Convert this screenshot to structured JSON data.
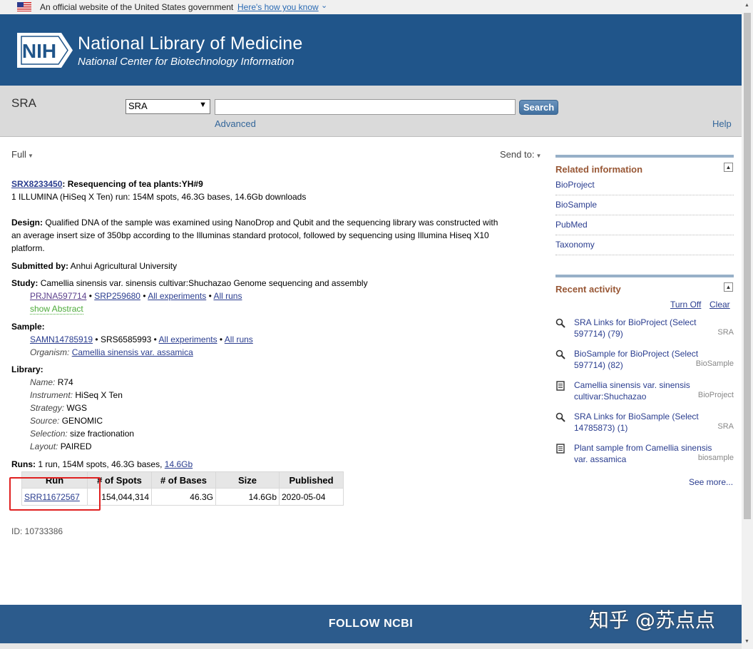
{
  "gov_banner": {
    "text": "An official website of the United States government",
    "link": "Here's how you know"
  },
  "header": {
    "logo_text": "NIH",
    "title": "National Library of Medicine",
    "subtitle": "National Center for Biotechnology Information"
  },
  "search": {
    "db_title": "SRA",
    "db_selected": "SRA",
    "term": "",
    "button": "Search",
    "advanced": "Advanced",
    "help": "Help"
  },
  "toolbar": {
    "format": "Full",
    "send_to": "Send to:"
  },
  "record": {
    "accession": "SRX8233450",
    "title": ": Resequencing of tea plants:YH#9",
    "summary": "1 ILLUMINA (HiSeq X Ten) run: 154M spots, 46.3G bases, 14.6Gb downloads",
    "design_label": "Design:",
    "design_line1": "Qualified DNA of the sample was examined using NanoDrop and Qubit and the sequencing library was constructed with",
    "design_line2": "an average insert size of 350bp according to the Illuminas standard protocol, followed by sequencing using Illumina Hiseq X10",
    "design_line3": "platform.",
    "submitted_label": "Submitted by:",
    "submitted_value": "Anhui Agricultural University",
    "study_label": "Study:",
    "study_value": "Camellia sinensis var. sinensis cultivar:Shuchazao Genome sequencing and assembly",
    "study_bioproject": "PRJNA597714",
    "study_srp": "SRP259680",
    "all_experiments": "All experiments",
    "all_runs": "All runs",
    "show_abstract": "show Abstract",
    "sample_label": "Sample:",
    "sample_biosample": "SAMN14785919",
    "sample_srs": "SRS6585993",
    "organism_label": "Organism:",
    "organism_value": "Camellia sinensis var. assamica",
    "library_label": "Library:",
    "library": {
      "name_label": "Name:",
      "name": "R74",
      "instrument_label": "Instrument:",
      "instrument": "HiSeq X Ten",
      "strategy_label": "Strategy:",
      "strategy": "WGS",
      "source_label": "Source:",
      "source": "GENOMIC",
      "selection_label": "Selection:",
      "selection": "size fractionation",
      "layout_label": "Layout:",
      "layout": "PAIRED"
    },
    "runs_label": "Runs:",
    "runs_summary": "1 run, 154M spots, 46.3G bases,",
    "runs_size_link": "14.6Gb",
    "runs_table": {
      "headers": [
        "Run",
        "# of Spots",
        "# of Bases",
        "Size",
        "Published"
      ],
      "rows": [
        [
          "SRR11672567",
          "154,044,314",
          "46.3G",
          "14.6Gb",
          "2020-05-04"
        ]
      ]
    },
    "id_line": "ID: 10733386"
  },
  "sidebar": {
    "related_title": "Related information",
    "related_items": [
      "BioProject",
      "BioSample",
      "PubMed",
      "Taxonomy"
    ],
    "recent_title": "Recent activity",
    "turn_off": "Turn Off",
    "clear": "Clear",
    "recent_items": [
      {
        "icon": "search-icon",
        "text": "SRA Links for BioProject (Select 597714) (79)",
        "db": "SRA"
      },
      {
        "icon": "search-icon",
        "text": "BioSample for BioProject (Select 597714) (82)",
        "db": "BioSample"
      },
      {
        "icon": "document-icon",
        "text": "Camellia sinensis var. sinensis cultivar:Shuchazao",
        "db": "BioProject"
      },
      {
        "icon": "search-icon",
        "text": "SRA Links for BioSample (Select 14785873) (1)",
        "db": "SRA"
      },
      {
        "icon": "document-icon",
        "text": "Plant sample from Camellia sinensis var. assamica",
        "db": "biosample"
      }
    ],
    "see_more": "See more..."
  },
  "footer": {
    "follow": "FOLLOW NCBI",
    "watermark": "知乎 @苏点点"
  },
  "colors": {
    "header_blue": "#20558a",
    "highlight_red": "#e02020",
    "sidebar_title": "#985735"
  }
}
